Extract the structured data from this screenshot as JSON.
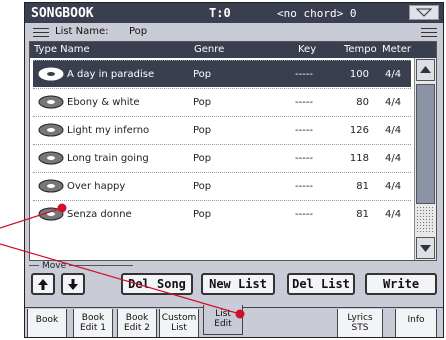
{
  "title_bar": {
    "mode": "SONGBOOK",
    "transpose": "T:0",
    "chord": "<no chord> 0"
  },
  "list_name": {
    "label": "List Name:",
    "value": "Pop"
  },
  "table": {
    "headers": {
      "type_name": "Type Name",
      "genre": "Genre",
      "key": "Key",
      "tempo": "Tempo",
      "meter": "Meter"
    },
    "rows": [
      {
        "name": "A day in paradise",
        "genre": "Pop",
        "key": "-----",
        "tempo": "100",
        "meter": "4/4",
        "selected": true
      },
      {
        "name": "Ebony & white",
        "genre": "Pop",
        "key": "-----",
        "tempo": "80",
        "meter": "4/4"
      },
      {
        "name": "Light my inferno",
        "genre": "Pop",
        "key": "-----",
        "tempo": "126",
        "meter": "4/4"
      },
      {
        "name": "Long train going",
        "genre": "Pop",
        "key": "-----",
        "tempo": "118",
        "meter": "4/4"
      },
      {
        "name": "Over happy",
        "genre": "Pop",
        "key": "-----",
        "tempo": "81",
        "meter": "4/4"
      },
      {
        "name": "Senza donne",
        "genre": "Pop",
        "key": "-----",
        "tempo": "81",
        "meter": "4/4"
      }
    ]
  },
  "move": {
    "label": "Move"
  },
  "buttons": {
    "del_song": "Del Song",
    "new_list": "New List",
    "del_list": "Del List",
    "write": "Write"
  },
  "tabs": [
    {
      "line1": "Book",
      "line2": ""
    },
    {
      "line1": "Book",
      "line2": "Edit 1"
    },
    {
      "line1": "Book",
      "line2": "Edit 2"
    },
    {
      "line1": "Custom",
      "line2": "List"
    },
    {
      "line1": "List",
      "line2": "Edit",
      "active": true
    },
    {
      "line1": "Lyrics",
      "line2": "STS"
    },
    {
      "line1": "Info",
      "line2": ""
    }
  ],
  "colors": {
    "screen_bg": "#c9ccd6",
    "title_bar": "#3a3f4f",
    "callout": "#d0102a"
  },
  "icons": [
    "menu-triangle-icon",
    "list-grip-icon",
    "song-disc-icon",
    "arrow-up-icon",
    "arrow-down-icon",
    "scroll-up-icon",
    "scroll-down-icon"
  ]
}
